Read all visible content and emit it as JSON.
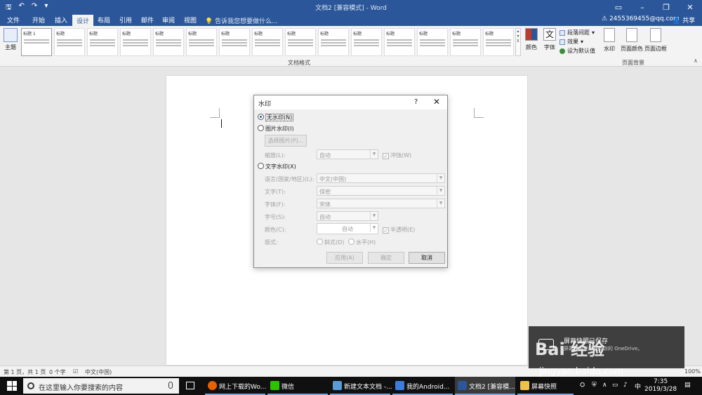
{
  "titlebar": {
    "title": "文档2 [兼容模式] - Word",
    "qat": {
      "save_icon": "save-icon",
      "undo_icon": "undo-icon",
      "redo_icon": "redo-icon"
    }
  },
  "tabs": {
    "file": "文件",
    "home": "开始",
    "insert": "插入",
    "design": "设计",
    "layout": "布局",
    "references": "引用",
    "mailings": "邮件",
    "review": "审阅",
    "view": "视图",
    "tellme": "告诉我您想要做什么...",
    "account": "2455369455@qq.com",
    "share": "共享"
  },
  "ribbon": {
    "theme_label": "主题",
    "gallery_heading": "标题",
    "gallery_first_heading": "标题 1",
    "document_format_label": "文档格式",
    "colors_label": "颜色",
    "fonts_label": "字体",
    "font_icon_glyph": "文",
    "paragraph_spacing": "段落间距",
    "effects": "效果",
    "set_default": "设为默认值",
    "watermark": "水印",
    "page_color": "页面颜色",
    "page_border": "页面边框",
    "page_background_label": "页面背景"
  },
  "dialog": {
    "title": "水印",
    "help": "?",
    "close": "✕",
    "no_watermark": "无水印(N)",
    "picture_watermark": "图片水印(I)",
    "select_picture": "选择图片(P)...",
    "scale_label": "缩放(L):",
    "scale_value": "自动",
    "washout": "冲蚀(W)",
    "text_watermark": "文字水印(X)",
    "language_label": "语言(国家/地区)(L):",
    "language_value": "中文(中国)",
    "text_label": "文字(T):",
    "text_value": "保密",
    "font_label": "字体(F):",
    "font_value": "宋体",
    "size_label": "字号(S):",
    "size_value": "自动",
    "color_label": "颜色(C):",
    "color_value": "自动",
    "semitransparent": "半透明(E)",
    "layout_label": "版式:",
    "diagonal": "斜式(D)",
    "horizontal": "水平(H)",
    "apply": "应用(A)",
    "ok": "确定",
    "cancel": "取消"
  },
  "statusbar": {
    "page": "第 1 页，共 1 页",
    "words": "0 个字",
    "language": "中文(中国)",
    "zoom": "100%"
  },
  "toast": {
    "title": "屏幕快照已保存",
    "body": "屏幕快照已添加到你的 OneDrive。",
    "watermark_text": "Bai 经验",
    "watermark_url": "jingyan.baidu.com"
  },
  "taskbar": {
    "search_placeholder": "在这里输入你要搜索的内容",
    "apps": [
      {
        "label": "网上下载的Wo...",
        "color": "#e66000"
      },
      {
        "label": "微信",
        "color": "#2dc100"
      },
      {
        "label": "新建文本文档 -...",
        "color": "#5a9bd5"
      },
      {
        "label": "我的Android...",
        "color": "#3b7ddd"
      },
      {
        "label": "文档2 [兼容模...",
        "color": "#2b579a"
      },
      {
        "label": "屏幕快照",
        "color": "#f0c14b"
      }
    ],
    "ime": "中",
    "time": "7:35",
    "date": "2019/3/28"
  }
}
